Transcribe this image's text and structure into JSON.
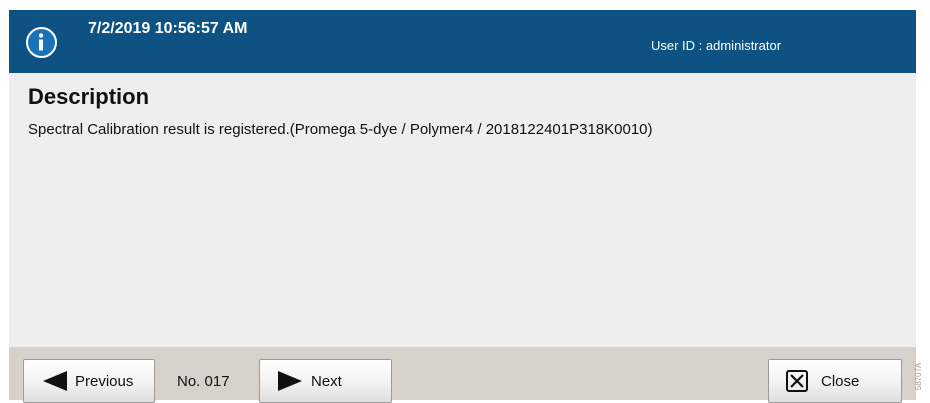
{
  "header": {
    "timestamp": "7/2/2019 10:56:57 AM",
    "user_id": "User ID : administrator",
    "icon": "info-icon"
  },
  "content": {
    "title": "Description",
    "message": "Spectral Calibration result is registered.(Promega 5-dye / Polymer4 / 2018122401P318K0010)"
  },
  "footer": {
    "previous_label": "Previous",
    "page_number": "No. 017",
    "next_label": "Next",
    "close_label": "Close"
  },
  "watermark": "5870TA",
  "colors": {
    "header_bg": "#0d5283",
    "body_bg": "#eeeeee",
    "footer_bg": "#d6d2cb"
  }
}
